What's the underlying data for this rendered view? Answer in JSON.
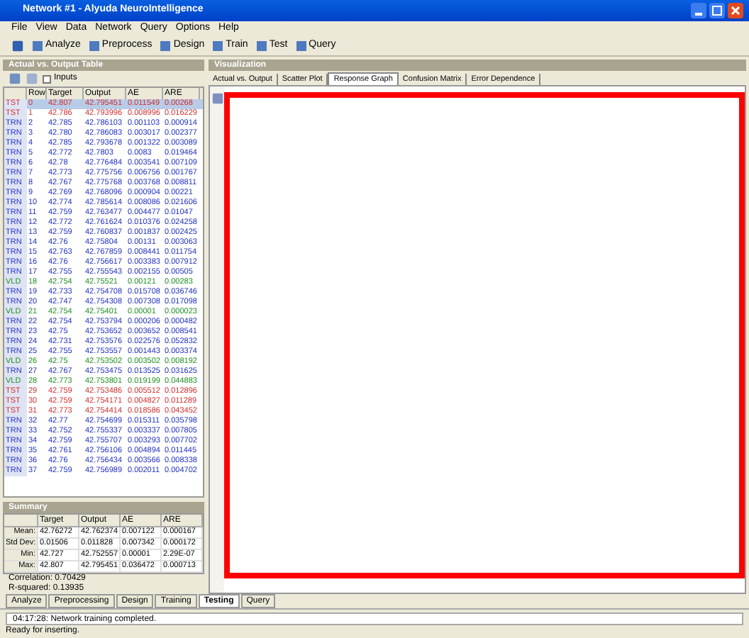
{
  "window": {
    "title": "Network #1 - Alyuda NeuroIntelligence"
  },
  "menu": [
    "File",
    "View",
    "Data",
    "Network",
    "Query",
    "Options",
    "Help"
  ],
  "toolbar": [
    "Analyze",
    "Preprocess",
    "Design",
    "Train",
    "Test",
    "Query"
  ],
  "table_panel": {
    "title": "Actual vs. Output Table",
    "inputs_label": "Inputs",
    "inputs_checked": false,
    "columns": [
      "",
      "Row",
      "Target",
      "Output",
      "AE",
      "ARE"
    ],
    "rows": [
      {
        "cells": [
          "TST",
          "0",
          "42.807",
          "42.795451",
          "0.011549",
          "0.00268"
        ],
        "color": "#d03030",
        "selected": true
      },
      {
        "cells": [
          "TST",
          "1",
          "42.786",
          "42.793996",
          "0.008996",
          "0.016229"
        ],
        "color": "#d03030",
        "selected": false
      },
      {
        "cells": [
          "TRN",
          "2",
          "42.785",
          "42.786103",
          "0.001103",
          "0.000914"
        ],
        "color": "#2030c0",
        "selected": false
      },
      {
        "cells": [
          "TRN",
          "3",
          "42.780",
          "42.786083",
          "0.003017",
          "0.002377"
        ],
        "color": "#2030c0",
        "selected": false
      },
      {
        "cells": [
          "TRN",
          "4",
          "42.785",
          "42.793678",
          "0.001322",
          "0.003089"
        ],
        "color": "#2030c0",
        "selected": false
      },
      {
        "cells": [
          "TRN",
          "5",
          "42.772",
          "42.7803",
          "0.0083",
          "0.019464"
        ],
        "color": "#2030c0",
        "selected": false
      },
      {
        "cells": [
          "TRN",
          "6",
          "42.78",
          "42.776484",
          "0.003541",
          "0.007109"
        ],
        "color": "#2030c0",
        "selected": false
      },
      {
        "cells": [
          "TRN",
          "7",
          "42.773",
          "42.775756",
          "0.006756",
          "0.001767"
        ],
        "color": "#2030c0",
        "selected": false
      },
      {
        "cells": [
          "TRN",
          "8",
          "42.767",
          "42.775768",
          "0.003768",
          "0.008811"
        ],
        "color": "#2030c0",
        "selected": false
      },
      {
        "cells": [
          "TRN",
          "9",
          "42.769",
          "42.768096",
          "0.000904",
          "0.00221"
        ],
        "color": "#2030c0",
        "selected": false
      },
      {
        "cells": [
          "TRN",
          "10",
          "42.774",
          "42.785614",
          "0.008086",
          "0.021606"
        ],
        "color": "#2030c0",
        "selected": false
      },
      {
        "cells": [
          "TRN",
          "11",
          "42.759",
          "42.763477",
          "0.004477",
          "0.01047"
        ],
        "color": "#2030c0",
        "selected": false
      },
      {
        "cells": [
          "TRN",
          "12",
          "42.772",
          "42.761624",
          "0.010376",
          "0.024258"
        ],
        "color": "#2030c0",
        "selected": false
      },
      {
        "cells": [
          "TRN",
          "13",
          "42.759",
          "42.760837",
          "0.001837",
          "0.002425"
        ],
        "color": "#2030c0",
        "selected": false
      },
      {
        "cells": [
          "TRN",
          "14",
          "42.76",
          "42.75804",
          "0.00131",
          "0.003063"
        ],
        "color": "#2030c0",
        "selected": false
      },
      {
        "cells": [
          "TRN",
          "15",
          "42.763",
          "42.767859",
          "0.008441",
          "0.011754"
        ],
        "color": "#2030c0",
        "selected": false
      },
      {
        "cells": [
          "TRN",
          "16",
          "42.76",
          "42.756617",
          "0.003383",
          "0.007912"
        ],
        "color": "#2030c0",
        "selected": false
      },
      {
        "cells": [
          "TRN",
          "17",
          "42.755",
          "42.755543",
          "0.002155",
          "0.00505"
        ],
        "color": "#2030c0",
        "selected": false
      },
      {
        "cells": [
          "VLD",
          "18",
          "42.754",
          "42.75521",
          "0.00121",
          "0.00283"
        ],
        "color": "#209020",
        "selected": false
      },
      {
        "cells": [
          "TRN",
          "19",
          "42.733",
          "42.754708",
          "0.015708",
          "0.036746"
        ],
        "color": "#2030c0",
        "selected": false
      },
      {
        "cells": [
          "TRN",
          "20",
          "42.747",
          "42.754308",
          "0.007308",
          "0.017098"
        ],
        "color": "#2030c0",
        "selected": false
      },
      {
        "cells": [
          "VLD",
          "21",
          "42.754",
          "42.75401",
          "0.00001",
          "0.000023"
        ],
        "color": "#209020",
        "selected": false
      },
      {
        "cells": [
          "TRN",
          "22",
          "42.754",
          "42.753794",
          "0.000206",
          "0.000482"
        ],
        "color": "#2030c0",
        "selected": false
      },
      {
        "cells": [
          "TRN",
          "23",
          "42.75",
          "42.753652",
          "0.003652",
          "0.008541"
        ],
        "color": "#2030c0",
        "selected": false
      },
      {
        "cells": [
          "TRN",
          "24",
          "42.731",
          "42.753576",
          "0.022576",
          "0.052832"
        ],
        "color": "#2030c0",
        "selected": false
      },
      {
        "cells": [
          "TRN",
          "25",
          "42.755",
          "42.753557",
          "0.001443",
          "0.003374"
        ],
        "color": "#2030c0",
        "selected": false
      },
      {
        "cells": [
          "VLD",
          "26",
          "42.75",
          "42.753502",
          "0.003502",
          "0.008192"
        ],
        "color": "#209020",
        "selected": false
      },
      {
        "cells": [
          "TRN",
          "27",
          "42.767",
          "42.753475",
          "0.013525",
          "0.031625"
        ],
        "color": "#2030c0",
        "selected": false
      },
      {
        "cells": [
          "VLD",
          "28",
          "42.773",
          "42.753801",
          "0.019199",
          "0.044883"
        ],
        "color": "#209020",
        "selected": false
      },
      {
        "cells": [
          "TST",
          "29",
          "42.759",
          "42.753486",
          "0.005512",
          "0.012896"
        ],
        "color": "#d03030",
        "selected": false
      },
      {
        "cells": [
          "TST",
          "30",
          "42.759",
          "42.754171",
          "0.004827",
          "0.011289"
        ],
        "color": "#d03030",
        "selected": false
      },
      {
        "cells": [
          "TST",
          "31",
          "42.773",
          "42.754414",
          "0.018586",
          "0.043452"
        ],
        "color": "#d03030",
        "selected": false
      },
      {
        "cells": [
          "TRN",
          "32",
          "42.77",
          "42.754699",
          "0.015311",
          "0.035798"
        ],
        "color": "#2030c0",
        "selected": false
      },
      {
        "cells": [
          "TRN",
          "33",
          "42.752",
          "42.755337",
          "0.003337",
          "0.007805"
        ],
        "color": "#2030c0",
        "selected": false
      },
      {
        "cells": [
          "TRN",
          "34",
          "42.759",
          "42.755707",
          "0.003293",
          "0.007702"
        ],
        "color": "#2030c0",
        "selected": false
      },
      {
        "cells": [
          "TRN",
          "35",
          "42.761",
          "42.756106",
          "0.004894",
          "0.011445"
        ],
        "color": "#2030c0",
        "selected": false
      },
      {
        "cells": [
          "TRN",
          "36",
          "42.76",
          "42.756434",
          "0.003566",
          "0.008338"
        ],
        "color": "#2030c0",
        "selected": false
      },
      {
        "cells": [
          "TRN",
          "37",
          "42.759",
          "42.756989",
          "0.002011",
          "0.004702"
        ],
        "color": "#2030c0",
        "selected": false
      }
    ]
  },
  "summary": {
    "title": "Summary",
    "columns": [
      "",
      "Target",
      "Output",
      "AE",
      "ARE"
    ],
    "rows": [
      [
        "Mean:",
        "42.76272",
        "42.762374",
        "0.007122",
        "0.000167"
      ],
      [
        "Std Dev:",
        "0.01506",
        "0.011828",
        "0.007342",
        "0.000172"
      ],
      [
        "Min:",
        "42.727",
        "42.752557",
        "0.00001",
        "2.29E-07"
      ],
      [
        "Max:",
        "42.807",
        "42.795451",
        "0.036472",
        "0.000713"
      ]
    ],
    "stats": [
      "Correlation: 0.70429",
      "R-squared: 0.13935"
    ]
  },
  "visualization": {
    "title": "Visualization",
    "tabs": [
      {
        "label": "Actual vs. Output",
        "selected": false
      },
      {
        "label": "Scatter Plot",
        "selected": false
      },
      {
        "label": "Response Graph",
        "selected": true
      },
      {
        "label": "Confusion Matrix",
        "selected": false
      },
      {
        "label": "Error Dependence",
        "selected": false
      }
    ]
  },
  "bottom_tabs": [
    {
      "label": "Analyze",
      "selected": false
    },
    {
      "label": "Preprocessing",
      "selected": false
    },
    {
      "label": "Design",
      "selected": false
    },
    {
      "label": "Training",
      "selected": false
    },
    {
      "label": "Testing",
      "selected": true
    },
    {
      "label": "Query",
      "selected": false
    }
  ],
  "log": "04:17:28: Network training completed.",
  "status_bar": "Ready for inserting."
}
